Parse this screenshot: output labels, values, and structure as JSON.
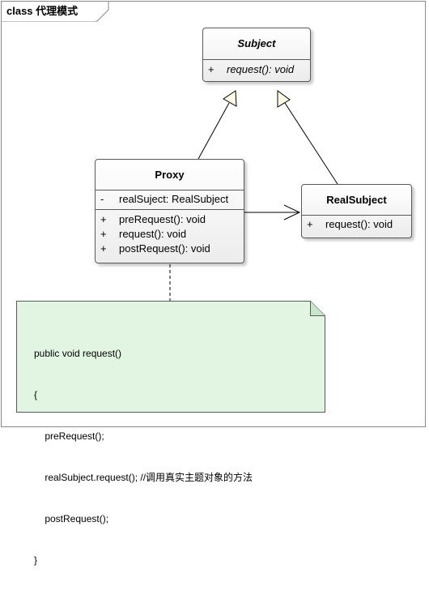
{
  "frame": {
    "title": "class 代理模式"
  },
  "classes": {
    "subject": {
      "name": "Subject",
      "operations": [
        {
          "visibility": "+",
          "text": "request(): void"
        }
      ]
    },
    "proxy": {
      "name": "Proxy",
      "attributes": [
        {
          "visibility": "-",
          "text": "realSuject: RealSubject"
        }
      ],
      "operations": [
        {
          "visibility": "+",
          "text": "preRequest(): void"
        },
        {
          "visibility": "+",
          "text": "request(): void"
        },
        {
          "visibility": "+",
          "text": "postRequest(): void"
        }
      ]
    },
    "realSubject": {
      "name": "RealSubject",
      "operations": [
        {
          "visibility": "+",
          "text": "request(): void"
        }
      ]
    }
  },
  "note": {
    "lines": [
      "public void request()",
      "{",
      "    preRequest();",
      "    realSubject.request(); //调用真实主题对象的方法",
      "    postRequest();",
      "}"
    ]
  },
  "colors": {
    "note_fill": "#e2f5e3",
    "border": "#5a5a5a",
    "line": "#000000"
  }
}
